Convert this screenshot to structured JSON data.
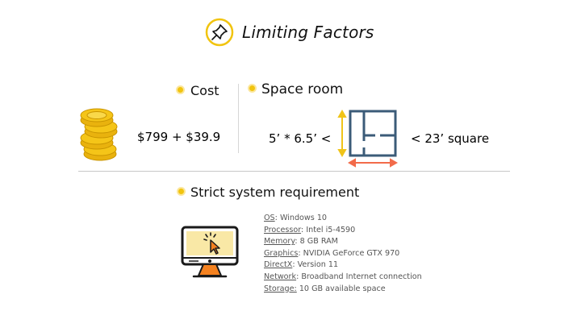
{
  "title": "Limiting Factors",
  "cost": {
    "heading": "Cost",
    "price": "$799 + $39.9"
  },
  "space": {
    "heading": "Space room",
    "dimensions": "5’ * 6.5’ <",
    "limit": "< 23’ square"
  },
  "requirements": {
    "heading": "Strict system requirement",
    "items": [
      {
        "key": "OS",
        "value": ": Windows 10"
      },
      {
        "key": "Processor",
        "value": ": Intel i5-4590"
      },
      {
        "key": "Memory",
        "value": ": 8 GB RAM"
      },
      {
        "key": "Graphics",
        "value": ": NVIDIA GeForce GTX 970"
      },
      {
        "key": "DirectX",
        "value": ": Version 11"
      },
      {
        "key": "Network",
        "value": ": Broadband Internet connection"
      },
      {
        "key": "Storage:",
        "value": " 10 GB available space"
      }
    ]
  },
  "icons": {
    "title": "pin-icon",
    "cost": "coins-icon",
    "space": "floorplan-icon",
    "requirements": "computer-icon"
  },
  "colors": {
    "accent": "#f1c40f",
    "coin": "#f5c518",
    "floorplan": "#3b5b78",
    "arrow_vertical": "#f0c419",
    "arrow_horizontal": "#f26b4a",
    "monitor_bg": "#f9e8a6",
    "monitor_stand": "#f58220",
    "text_muted": "#555555"
  }
}
